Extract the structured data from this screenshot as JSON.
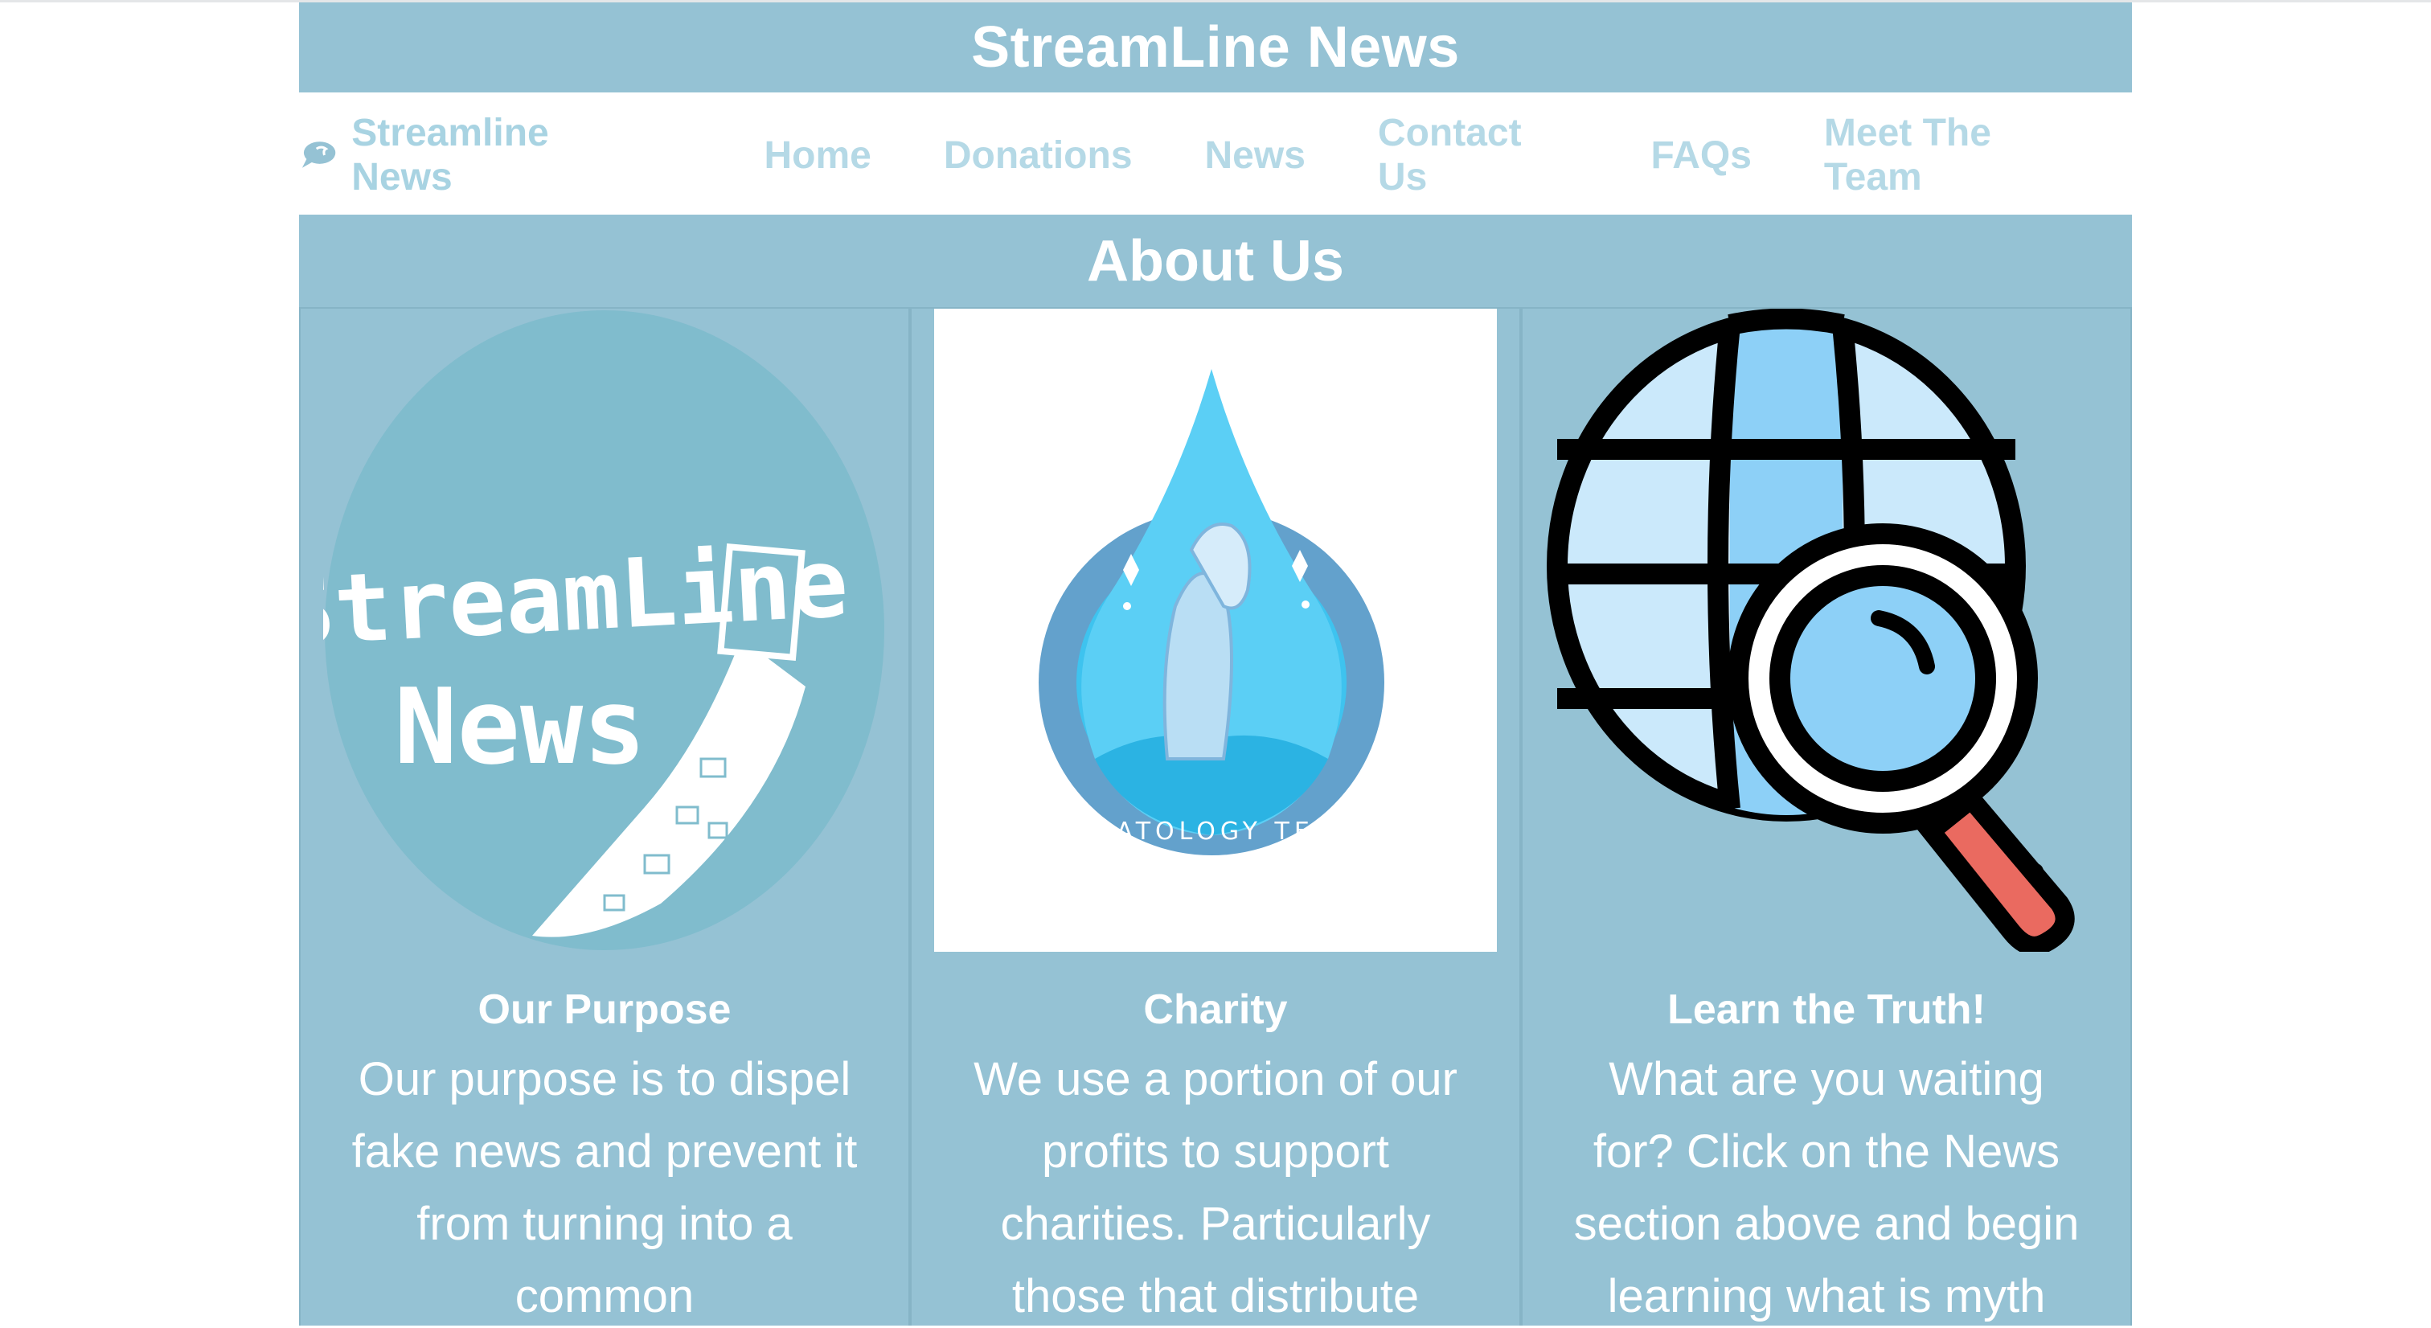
{
  "header": {
    "title": "StreamLine News"
  },
  "nav": {
    "brand_label": "Streamline News",
    "links": [
      "Home",
      "Donations",
      "News",
      "Contact Us",
      "FAQs",
      "Meet The Team"
    ]
  },
  "section": {
    "title": "About Us"
  },
  "cards": [
    {
      "heading": "Our Purpose",
      "text": "Our purpose is to dispel fake news and prevent it from turning into a common",
      "logo_text_line1": "StreamLine",
      "logo_text_line2": "News"
    },
    {
      "heading": "Charity",
      "text": "We use a portion of our profits to support charities. Particularly those that distribute",
      "badge_text": "DERMATOLOGY TESTED"
    },
    {
      "heading": "Learn the Truth!",
      "text": "What are you waiting for? Click on the News section above and begin learning what is myth"
    }
  ],
  "colors": {
    "accent": "#95c2d4",
    "nav_text": "#b5d9e6",
    "white": "#ffffff"
  }
}
